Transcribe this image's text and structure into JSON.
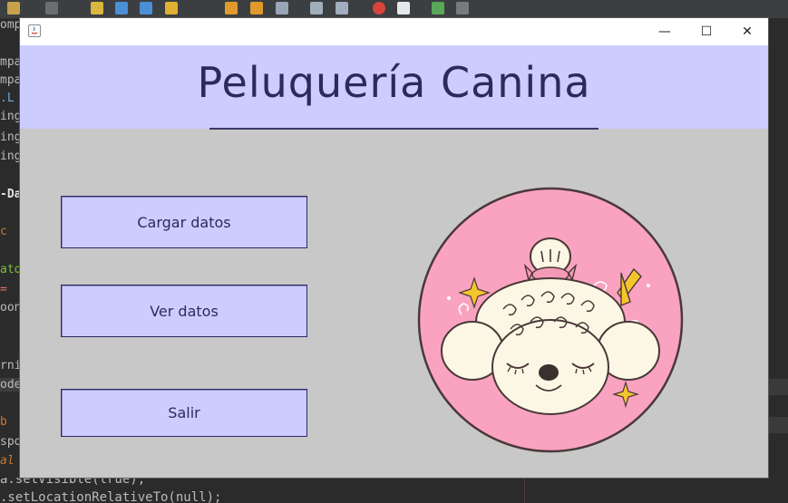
{
  "ide": {
    "code_fragments": [
      "omp",
      "mpa",
      "mpa",
      ".L",
      "ing",
      "ing",
      "ing",
      "-Da",
      "c",
      "ato",
      "=",
      "oon",
      "rni",
      "ode",
      "b",
      "spo",
      "al"
    ],
    "bottom_lines": [
      "a.setVisible(true);",
      ".setLocationRelativeTo(null);"
    ]
  },
  "window": {
    "minimize_glyph": "—",
    "maximize_glyph": "☐",
    "close_glyph": "✕"
  },
  "header": {
    "title": "Peluquería Canina"
  },
  "buttons": {
    "load_label": "Cargar datos",
    "view_label": "Ver datos",
    "exit_label": "Salir"
  },
  "logo": {
    "icon": "poodle-dog-icon",
    "circle_color": "#f9a3c0",
    "fur_color": "#fbf7e4",
    "accent_color": "#f5c62c"
  }
}
